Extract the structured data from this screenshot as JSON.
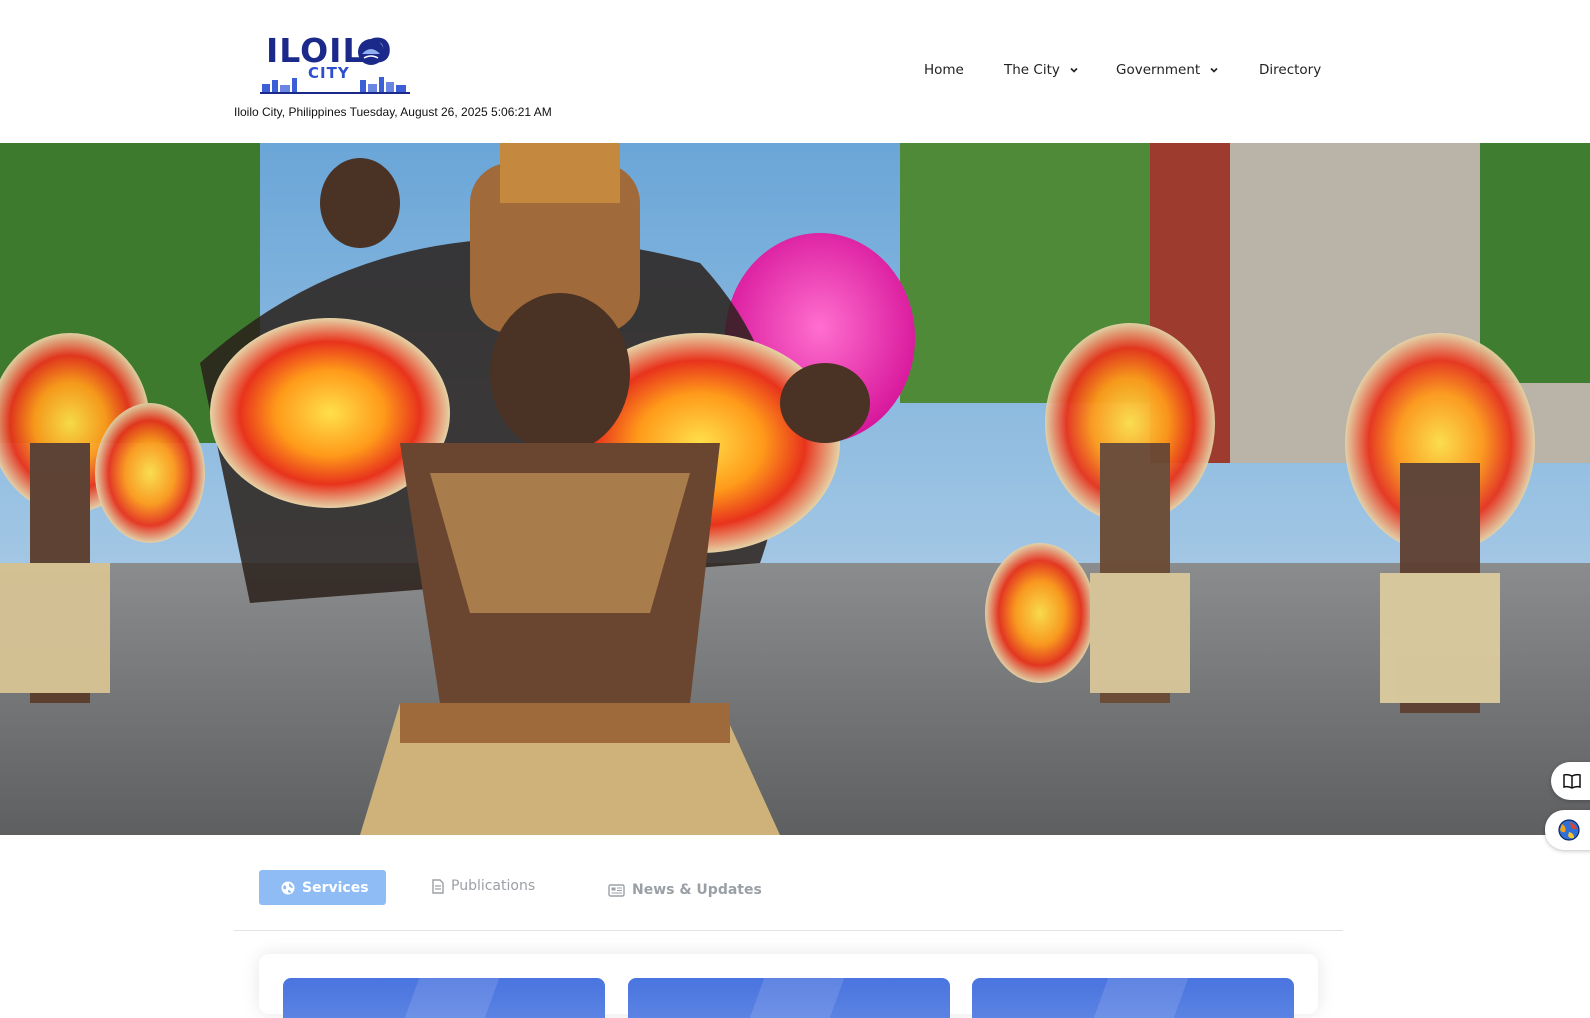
{
  "header": {
    "logo": {
      "text": "ILOILO",
      "sub": "CITY",
      "icon": "iloilo-city-seal-logo"
    },
    "datetime": "Iloilo City, Philippines Tuesday, August 26, 2025 5:06:21 AM",
    "nav": [
      {
        "label": "Home",
        "has_dropdown": false
      },
      {
        "label": "The City",
        "has_dropdown": true
      },
      {
        "label": "Government",
        "has_dropdown": true
      },
      {
        "label": "Directory",
        "has_dropdown": false
      }
    ]
  },
  "hero": {
    "image": "dinagyang-festival-dancers-photo"
  },
  "side_widgets": [
    {
      "icon": "reader-book-icon"
    },
    {
      "icon": "language-globe-icon"
    }
  ],
  "tabs": [
    {
      "label": "Services",
      "icon": "globe-icon",
      "active": true
    },
    {
      "label": "Publications",
      "icon": "document-icon",
      "active": false
    },
    {
      "label": "News & Updates",
      "icon": "newspaper-icon",
      "active": false
    }
  ],
  "colors": {
    "brand_navy": "#1b2a8a",
    "brand_blue": "#2f4ecf",
    "tab_active": "#8fbcf5",
    "card_blue": "#4a74df"
  }
}
